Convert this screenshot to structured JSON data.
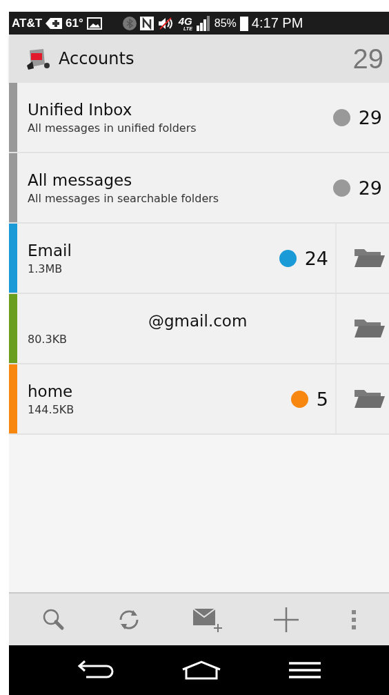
{
  "status_bar": {
    "carrier": "AT&T",
    "temperature": "61°",
    "network": "4G",
    "network_sub": "LTE",
    "battery": "85%",
    "time": "4:17 PM",
    "muted": true
  },
  "header": {
    "title": "Accounts",
    "count": "29"
  },
  "accounts": [
    {
      "kind": "unified",
      "name": "Unified Inbox",
      "detail": "All messages in unified folders",
      "count": "29",
      "color": "#999999"
    },
    {
      "kind": "unified",
      "name": "All messages",
      "detail": "All messages in searchable folders",
      "count": "29",
      "color": "#999999"
    },
    {
      "kind": "account",
      "name": "Email",
      "detail": "1.3MB",
      "count": "24",
      "color": "#1a9ad6"
    },
    {
      "kind": "account",
      "name": "@gmail.com",
      "detail": "80.3KB",
      "color": "#6a9e1f"
    },
    {
      "kind": "account",
      "name": "home",
      "detail": "144.5KB",
      "count": "5",
      "color": "#f7870f"
    }
  ]
}
